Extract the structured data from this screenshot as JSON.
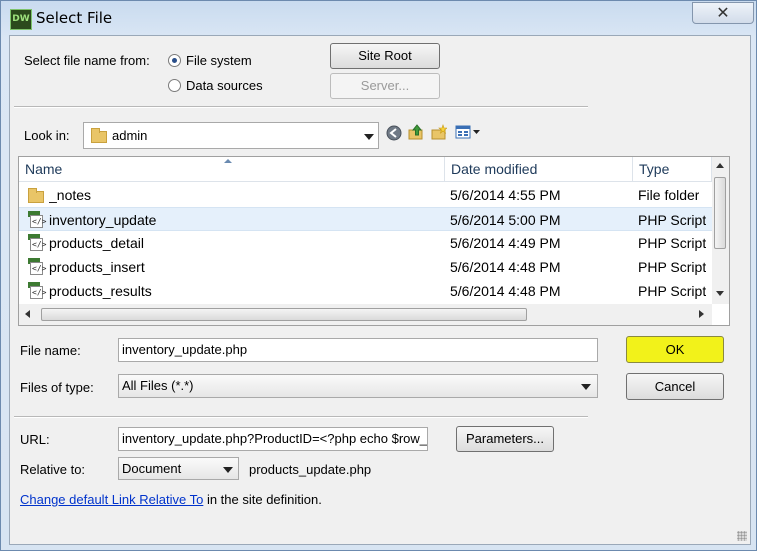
{
  "window": {
    "title": "Select File",
    "app_badge": "DW",
    "close_glyph": "✕"
  },
  "source": {
    "label": "Select file name from:",
    "options": [
      {
        "label": "File system",
        "selected": true
      },
      {
        "label": "Data sources",
        "selected": false
      }
    ],
    "site_root_label": "Site Root",
    "server_label": "Server..."
  },
  "lookin": {
    "label": "Look in:",
    "value": "admin"
  },
  "list": {
    "columns": [
      "Name",
      "Date modified",
      "Type"
    ],
    "rows": [
      {
        "name": "_notes",
        "date": "5/6/2014 4:55 PM",
        "type": "File folder",
        "icon": "folder-icon",
        "selected": false
      },
      {
        "name": "inventory_update",
        "date": "5/6/2014 5:00 PM",
        "type": "PHP Script",
        "icon": "php-file-icon",
        "selected": true
      },
      {
        "name": "products_detail",
        "date": "5/6/2014 4:49 PM",
        "type": "PHP Script",
        "icon": "php-file-icon",
        "selected": false
      },
      {
        "name": "products_insert",
        "date": "5/6/2014 4:48 PM",
        "type": "PHP Script",
        "icon": "php-file-icon",
        "selected": false
      },
      {
        "name": "products_results",
        "date": "5/6/2014 4:48 PM",
        "type": "PHP Script",
        "icon": "php-file-icon",
        "selected": false
      }
    ]
  },
  "filename": {
    "label": "File name:",
    "value": "inventory_update.php"
  },
  "filetype": {
    "label": "Files of type:",
    "value": "All Files (*.*)"
  },
  "ok_label": "OK",
  "cancel_label": "Cancel",
  "url": {
    "label": "URL:",
    "value": "inventory_update.php?ProductID=<?php echo $row_",
    "parameters_label": "Parameters..."
  },
  "relative": {
    "label": "Relative to:",
    "value": "Document",
    "file": "products_update.php"
  },
  "footer": {
    "link": "Change default Link Relative To",
    "suffix": " in the site definition."
  },
  "colors": {
    "ok_highlight": "#f2f21a",
    "selection": "#e5f0fb",
    "link": "#0033cc"
  }
}
